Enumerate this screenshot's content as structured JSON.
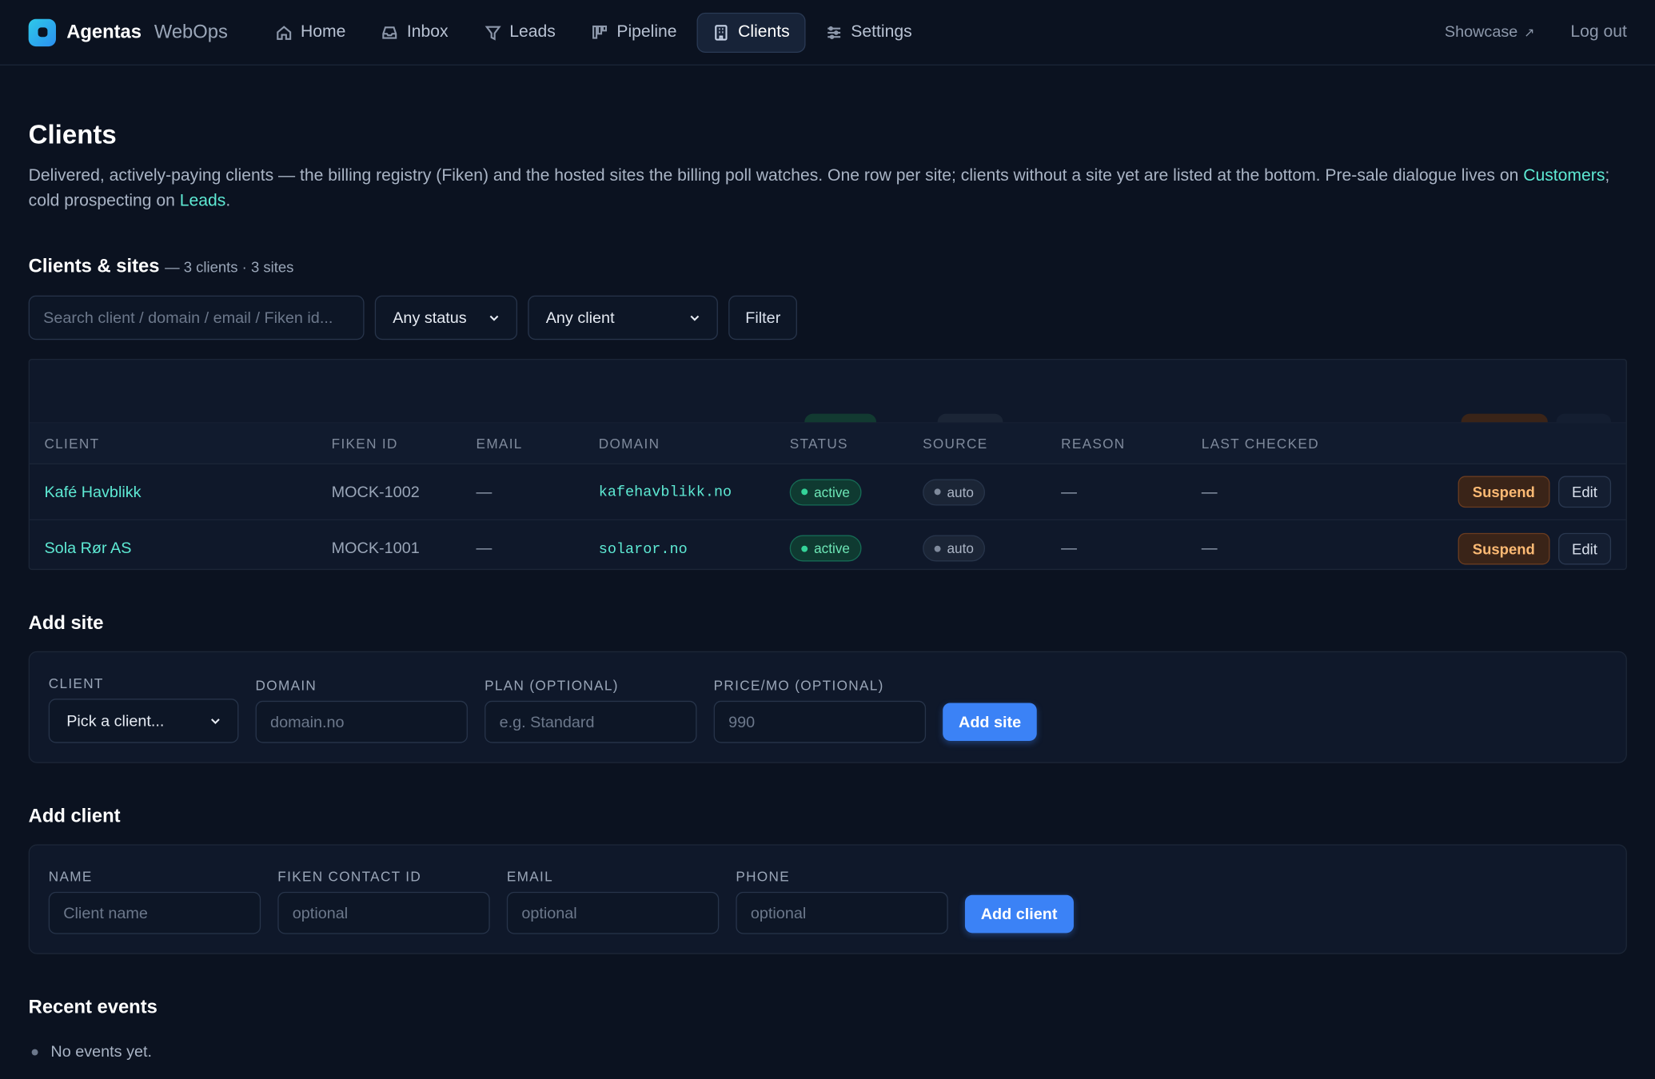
{
  "brand": {
    "name": "Agentas",
    "sub": "WebOps"
  },
  "nav": {
    "items": [
      {
        "label": "Home",
        "icon": "home-icon"
      },
      {
        "label": "Inbox",
        "icon": "inbox-icon"
      },
      {
        "label": "Leads",
        "icon": "filter-icon"
      },
      {
        "label": "Pipeline",
        "icon": "kanban-icon"
      },
      {
        "label": "Clients",
        "icon": "building-icon",
        "active": true
      },
      {
        "label": "Settings",
        "icon": "sliders-icon"
      }
    ],
    "showcase": "Showcase",
    "showcase_icon": "↗",
    "logout": "Log out"
  },
  "page": {
    "title": "Clients",
    "intro_text": "Delivered, actively-paying clients — the billing registry (Fiken) and the hosted sites the billing poll watches. One row per site; clients without a site yet are listed at the bottom. Pre-sale dialogue lives on ",
    "intro_link1": "Customers",
    "intro_mid": "; cold prospecting on ",
    "intro_link2": "Leads",
    "intro_end": "."
  },
  "clients_sites": {
    "title": "Clients & sites",
    "meta": "— 3 clients · 3 sites",
    "search_placeholder": "Search client / domain / email / Fiken id...",
    "status_filter": "Any status",
    "client_filter": "Any client",
    "filter_button": "Filter",
    "columns": [
      "Client",
      "Fiken ID",
      "Email",
      "Domain",
      "Status",
      "Source",
      "Reason",
      "Last checked"
    ],
    "rows": [
      {
        "client": "Kafé Havblikk",
        "fiken": "MOCK-1002",
        "email": "—",
        "domain": "kafehavblikk.no",
        "status": "active",
        "source": "auto",
        "reason": "—",
        "checked": "—",
        "suspend": "Suspend",
        "edit": "Edit"
      },
      {
        "client": "Sola Rør AS",
        "fiken": "MOCK-1001",
        "email": "—",
        "domain": "solaror.no",
        "status": "active",
        "source": "auto",
        "reason": "—",
        "checked": "—",
        "suspend": "Suspend",
        "edit": "Edit"
      }
    ]
  },
  "add_site": {
    "title": "Add site",
    "client_label": "Client",
    "client_value": "Pick a client...",
    "domain_label": "Domain",
    "domain_placeholder": "domain.no",
    "plan_label": "Plan (optional)",
    "plan_placeholder": "e.g. Standard",
    "price_label": "Price/mo (optional)",
    "price_placeholder": "990",
    "button": "Add site"
  },
  "add_client": {
    "title": "Add client",
    "name_label": "Name",
    "name_placeholder": "Client name",
    "fiken_label": "Fiken contact ID",
    "fiken_placeholder": "optional",
    "email_label": "Email",
    "email_placeholder": "optional",
    "phone_label": "Phone",
    "phone_placeholder": "optional",
    "button": "Add client"
  },
  "events": {
    "title": "Recent events",
    "empty": "No events yet."
  }
}
